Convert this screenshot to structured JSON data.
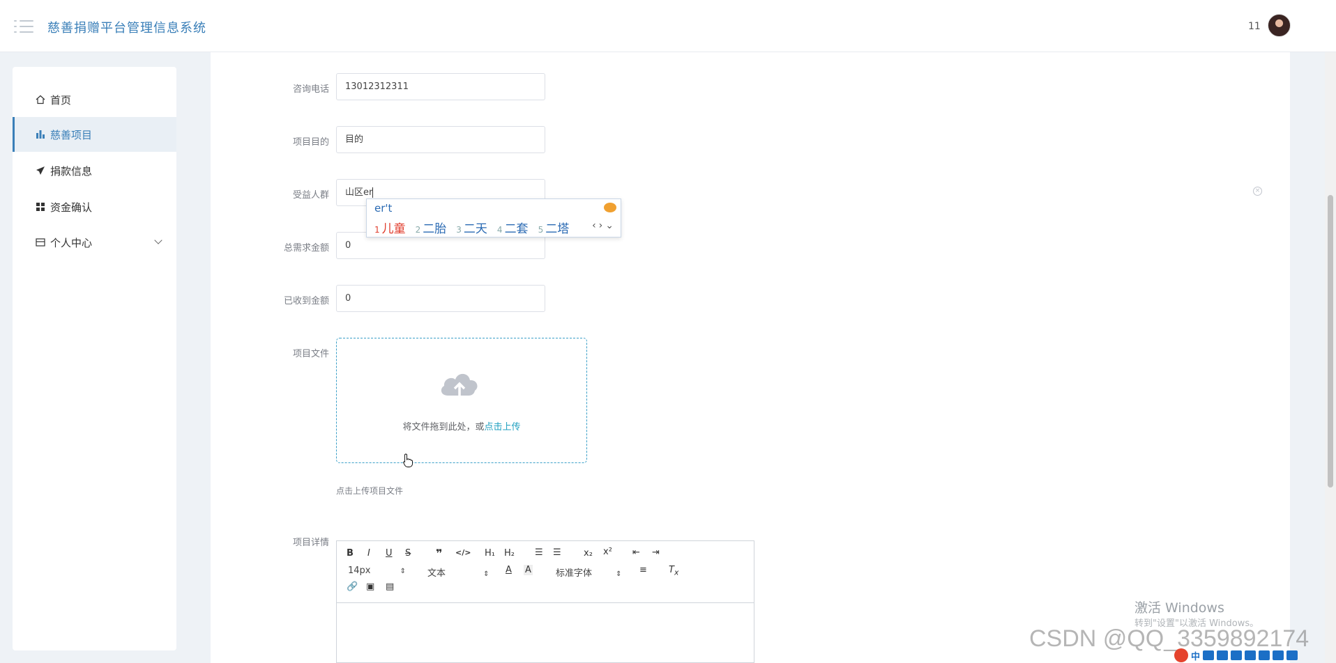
{
  "header": {
    "title": "慈善捐赠平台管理信息系统",
    "user": "11"
  },
  "sidebar": {
    "items": [
      {
        "label": "首页",
        "icon": "home-icon"
      },
      {
        "label": "慈善项目",
        "icon": "bar-chart-icon"
      },
      {
        "label": "捐款信息",
        "icon": "send-icon"
      },
      {
        "label": "资金确认",
        "icon": "grid-icon"
      },
      {
        "label": "个人中心",
        "icon": "wallet-icon"
      }
    ]
  },
  "form": {
    "phone": {
      "label": "咨询电话",
      "value": "13012312311"
    },
    "purpose": {
      "label": "项目目的",
      "value": "目的"
    },
    "beneficiary": {
      "label": "受益人群",
      "value": "山区er"
    },
    "total_need": {
      "label": "总需求金额",
      "value": "0"
    },
    "received": {
      "label": "已收到金额",
      "value": "0"
    },
    "file": {
      "label": "项目文件",
      "drop_text": "将文件拖到此处，或",
      "link_text": "点击上传",
      "hint": "点击上传项目文件"
    },
    "detail": {
      "label": "项目详情"
    }
  },
  "ime": {
    "input": "er't",
    "candidates": [
      {
        "num": "1",
        "text": "儿童"
      },
      {
        "num": "2",
        "text": "二胎"
      },
      {
        "num": "3",
        "text": "二天"
      },
      {
        "num": "4",
        "text": "二套"
      },
      {
        "num": "5",
        "text": "二塔"
      }
    ]
  },
  "editor": {
    "font_size": "14px",
    "header": "文本",
    "font_family": "标准字体"
  },
  "watermarks": {
    "windows_title": "激活 Windows",
    "windows_sub": "转到\"设置\"以激活 Windows。",
    "csdn": "CSDN @QQ_3359892174"
  },
  "tray": {
    "ime_lang": "中"
  }
}
